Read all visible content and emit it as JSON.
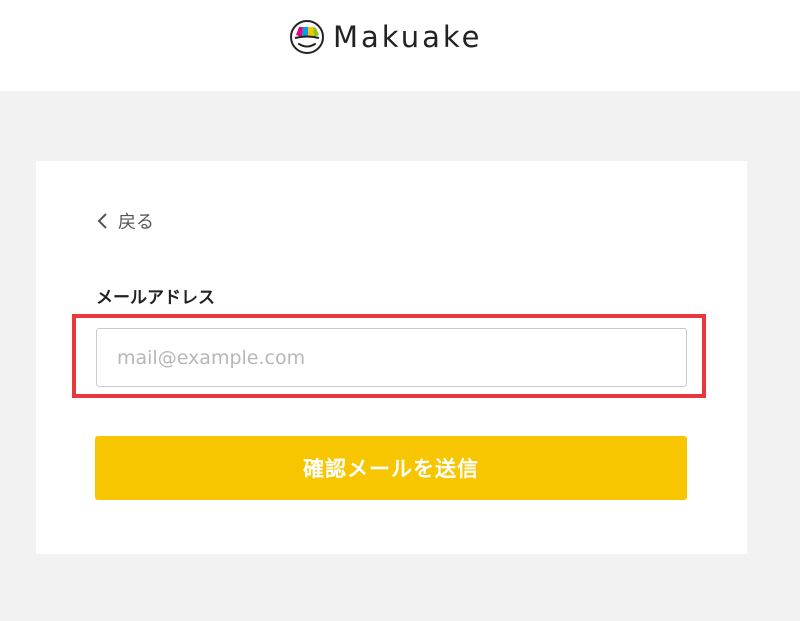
{
  "header": {
    "brand_name": "Makuake",
    "logo_icon": "makuake-logo-icon"
  },
  "form": {
    "back_label": "戻る",
    "back_icon": "chevron-left-icon",
    "email_label": "メールアドレス",
    "email_placeholder": "mail@example.com",
    "email_value": "",
    "submit_label": "確認メールを送信"
  },
  "colors": {
    "accent": "#f7c600",
    "highlight": "#e8383d",
    "background": "#f2f2f2"
  }
}
